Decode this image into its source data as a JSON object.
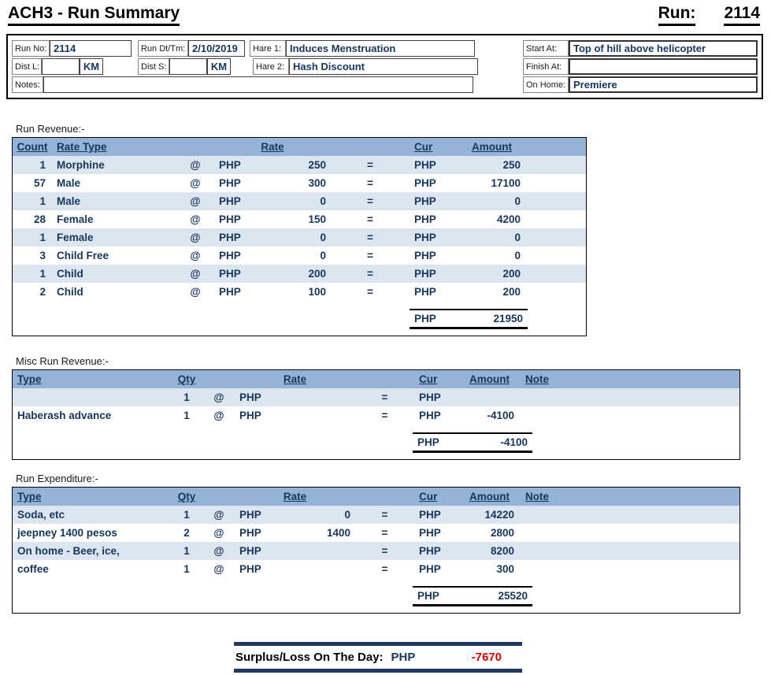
{
  "page": {
    "title": "ACH3 - Run Summary",
    "run_label": "Run:",
    "run_number": "2114"
  },
  "header": {
    "run_no_label": "Run No:",
    "run_no": "2114",
    "run_dt_label": "Run Dt/Tm:",
    "run_dt": "2/10/2019",
    "hare1_label": "Hare 1:",
    "hare1": "Induces Menstruation",
    "start_at_label": "Start At:",
    "start_at": "Top of hill above helicopter",
    "dist_l_label": "Dist L:",
    "dist_l": "",
    "dist_l_unit": "KM",
    "dist_s_label": "Dist S:",
    "dist_s": "",
    "dist_s_unit": "KM",
    "hare2_label": "Hare 2:",
    "hare2": "Hash Discount",
    "finish_at_label": "Finish At:",
    "finish_at": "",
    "notes_label": "Notes:",
    "notes": "",
    "on_home_label": "On Home:",
    "on_home": "Premiere"
  },
  "revenue": {
    "section_label": "Run Revenue:-",
    "headers": {
      "count": "Count",
      "rate_type": "Rate Type",
      "rate": "Rate",
      "cur": "Cur",
      "amount": "Amount"
    },
    "rows": [
      {
        "count": "1",
        "rate_type": "Morphine",
        "at": "@",
        "cur1": "PHP",
        "rate": "250",
        "eq": "=",
        "cur": "PHP",
        "amount": "250"
      },
      {
        "count": "57",
        "rate_type": "Male",
        "at": "@",
        "cur1": "PHP",
        "rate": "300",
        "eq": "=",
        "cur": "PHP",
        "amount": "17100"
      },
      {
        "count": "1",
        "rate_type": "Male",
        "at": "@",
        "cur1": "PHP",
        "rate": "0",
        "eq": "=",
        "cur": "PHP",
        "amount": "0"
      },
      {
        "count": "28",
        "rate_type": "Female",
        "at": "@",
        "cur1": "PHP",
        "rate": "150",
        "eq": "=",
        "cur": "PHP",
        "amount": "4200"
      },
      {
        "count": "1",
        "rate_type": "Female",
        "at": "@",
        "cur1": "PHP",
        "rate": "0",
        "eq": "=",
        "cur": "PHP",
        "amount": "0"
      },
      {
        "count": "3",
        "rate_type": "Child Free",
        "at": "@",
        "cur1": "PHP",
        "rate": "0",
        "eq": "=",
        "cur": "PHP",
        "amount": "0"
      },
      {
        "count": "1",
        "rate_type": "Child",
        "at": "@",
        "cur1": "PHP",
        "rate": "200",
        "eq": "=",
        "cur": "PHP",
        "amount": "200"
      },
      {
        "count": "2",
        "rate_type": "Child",
        "at": "@",
        "cur1": "PHP",
        "rate": "100",
        "eq": "=",
        "cur": "PHP",
        "amount": "200"
      }
    ],
    "total_cur": "PHP",
    "total_amount": "21950"
  },
  "misc_revenue": {
    "section_label": "Misc Run Revenue:-",
    "headers": {
      "type": "Type",
      "qty": "Qty",
      "rate": "Rate",
      "cur": "Cur",
      "amount": "Amount",
      "note": "Note"
    },
    "rows": [
      {
        "type": "",
        "qty": "1",
        "at": "@",
        "cur1": "PHP",
        "rate": "",
        "eq": "=",
        "cur": "PHP",
        "amount": "",
        "note": ""
      },
      {
        "type": "Haberash advance",
        "qty": "1",
        "at": "@",
        "cur1": "PHP",
        "rate": "",
        "eq": "=",
        "cur": "PHP",
        "amount": "-4100",
        "note": ""
      }
    ],
    "total_cur": "PHP",
    "total_amount": "-4100"
  },
  "expenditure": {
    "section_label": "Run Expenditure:-",
    "headers": {
      "type": "Type",
      "qty": "Qty",
      "rate": "Rate",
      "cur": "Cur",
      "amount": "Amount",
      "note": "Note"
    },
    "rows": [
      {
        "type": "Soda, etc",
        "qty": "1",
        "at": "@",
        "cur1": "PHP",
        "rate": "0",
        "eq": "=",
        "cur": "PHP",
        "amount": "14220",
        "note": ""
      },
      {
        "type": "jeepney 1400 pesos",
        "qty": "2",
        "at": "@",
        "cur1": "PHP",
        "rate": "1400",
        "eq": "=",
        "cur": "PHP",
        "amount": "2800",
        "note": ""
      },
      {
        "type": "On home - Beer, ice,",
        "qty": "1",
        "at": "@",
        "cur1": "PHP",
        "rate": "",
        "eq": "=",
        "cur": "PHP",
        "amount": "8200",
        "note": ""
      },
      {
        "type": "coffee",
        "qty": "1",
        "at": "@",
        "cur1": "PHP",
        "rate": "",
        "eq": "=",
        "cur": "PHP",
        "amount": "300",
        "note": ""
      }
    ],
    "total_cur": "PHP",
    "total_amount": "25520"
  },
  "surplus": {
    "label": "Surplus/Loss On The Day:",
    "cur": "PHP",
    "amount": "-7670"
  },
  "colors": {
    "table_header": "#95B3D7",
    "row_alt": "#DCE6F1",
    "data_text": "#17365D",
    "negative": "#E60000",
    "bar": "#1F3864"
  }
}
